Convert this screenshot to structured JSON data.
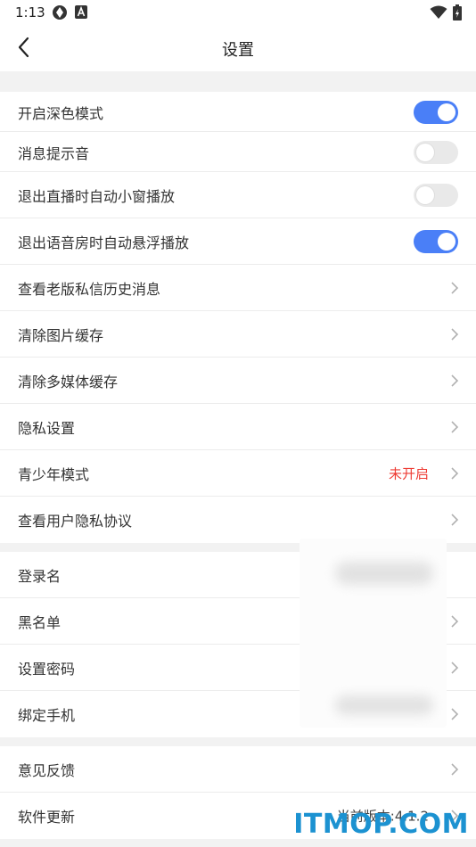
{
  "status_bar": {
    "time": "1:13",
    "icons": [
      "sync-icon",
      "text-icon",
      "wifi-icon",
      "battery-charging-icon"
    ]
  },
  "nav": {
    "title": "设置",
    "back_icon": "chevron-left-icon"
  },
  "sections": [
    {
      "items": [
        {
          "label": "开启深色模式",
          "type": "toggle",
          "checked": true
        },
        {
          "label": "消息提示音",
          "type": "toggle",
          "checked": false
        },
        {
          "label": "退出直播时自动小窗播放",
          "type": "toggle",
          "checked": false
        },
        {
          "label": "退出语音房时自动悬浮播放",
          "type": "toggle",
          "checked": true
        },
        {
          "label": "查看老版私信历史消息",
          "type": "link"
        },
        {
          "label": "清除图片缓存",
          "type": "link"
        },
        {
          "label": "清除多媒体缓存",
          "type": "link"
        },
        {
          "label": "隐私设置",
          "type": "link"
        },
        {
          "label": "青少年模式",
          "type": "link",
          "value": "未开启",
          "value_color": "#ee3b33"
        },
        {
          "label": "查看用户隐私协议",
          "type": "link"
        }
      ]
    },
    {
      "items": [
        {
          "label": "登录名",
          "type": "text"
        },
        {
          "label": "黑名单",
          "type": "link"
        },
        {
          "label": "设置密码",
          "type": "link"
        },
        {
          "label": "绑定手机",
          "type": "link"
        }
      ]
    },
    {
      "items": [
        {
          "label": "意见反馈",
          "type": "link"
        },
        {
          "label": "软件更新",
          "type": "link",
          "value": "当前版本:4.1.2"
        }
      ]
    }
  ],
  "watermark": "ITMOP.COM",
  "colors": {
    "accent": "#4a7ff7",
    "warning": "#ee3b33",
    "section_gap": "#f2f2f2",
    "watermark": "#1c92d1"
  }
}
